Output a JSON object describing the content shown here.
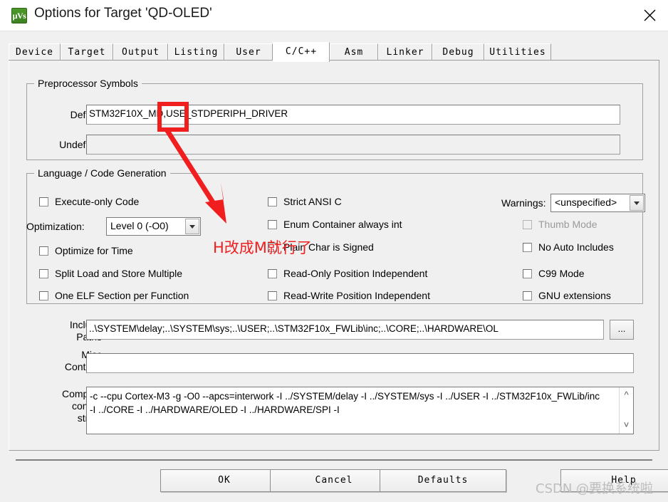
{
  "window": {
    "title": "Options for Target 'QD-OLED'",
    "app_icon": "keil-uvision-icon",
    "close_icon": "close-icon"
  },
  "tabs": [
    {
      "label": "Device",
      "selected": false
    },
    {
      "label": "Target",
      "selected": false
    },
    {
      "label": "Output",
      "selected": false
    },
    {
      "label": "Listing",
      "selected": false
    },
    {
      "label": "User",
      "selected": false
    },
    {
      "label": "C/C++",
      "selected": true
    },
    {
      "label": "Asm",
      "selected": false
    },
    {
      "label": "Linker",
      "selected": false
    },
    {
      "label": "Debug",
      "selected": false
    },
    {
      "label": "Utilities",
      "selected": false
    }
  ],
  "preprocessor": {
    "group_title": "Preprocessor Symbols",
    "define_label": "Define:",
    "define_value": "STM32F10X_MD,USE_STDPERIPH_DRIVER",
    "undefine_label": "Undefine:",
    "undefine_value": ""
  },
  "language": {
    "group_title": "Language / Code Generation",
    "column_left": [
      {
        "label": "Execute-only Code",
        "checked": false,
        "enabled": true
      },
      {
        "label": "Optimize for Time",
        "checked": false,
        "enabled": true
      },
      {
        "label": "Split Load and Store Multiple",
        "checked": false,
        "enabled": true
      },
      {
        "label": "One ELF Section per Function",
        "checked": false,
        "enabled": true
      }
    ],
    "optimization_label": "Optimization:",
    "optimization_value": "Level 0 (-O0)",
    "column_middle": [
      {
        "label": "Strict ANSI C",
        "checked": false,
        "enabled": true
      },
      {
        "label": "Enum Container always int",
        "checked": false,
        "enabled": true
      },
      {
        "label": "Plain Char is Signed",
        "checked": false,
        "enabled": true
      },
      {
        "label": "Read-Only Position Independent",
        "checked": false,
        "enabled": true
      },
      {
        "label": "Read-Write Position Independent",
        "checked": false,
        "enabled": true
      }
    ],
    "warnings_label": "Warnings:",
    "warnings_value": "<unspecified>",
    "column_right": [
      {
        "label": "Thumb Mode",
        "checked": false,
        "enabled": false
      },
      {
        "label": "No Auto Includes",
        "checked": false,
        "enabled": true
      },
      {
        "label": "C99 Mode",
        "checked": false,
        "enabled": true
      },
      {
        "label": "GNU extensions",
        "checked": false,
        "enabled": true
      }
    ]
  },
  "paths": {
    "include_label_line1": "Include",
    "include_label_line2": "Paths",
    "include_value": "..\\SYSTEM\\delay;..\\SYSTEM\\sys;..\\USER;..\\STM32F10x_FWLib\\inc;..\\CORE;..\\HARDWARE\\OL",
    "browse_label": "...",
    "misc_label_line1": "Misc",
    "misc_label_line2": "Controls",
    "misc_value": "",
    "compiler_label_line1": "Compiler",
    "compiler_label_line2": "control",
    "compiler_label_line3": "string",
    "compiler_value": "-c --cpu Cortex-M3 -g -O0 --apcs=interwork -I ../SYSTEM/delay -I ../SYSTEM/sys -I ../USER -I ../STM32F10x_FWLib/inc -I ../CORE -I ../HARDWARE/OLED -I ../HARDWARE/SPI -I",
    "scroll_up_icon": "chevron-up-icon",
    "scroll_down_icon": "chevron-down-icon"
  },
  "buttons": {
    "ok": "OK",
    "cancel": "Cancel",
    "defaults": "Defaults",
    "help": "Help"
  },
  "annotations": {
    "red_box_target": "_MD",
    "red_note": "H改成M就行了",
    "watermark": "CSDN @要换系统啦",
    "accent_red": "#f01e1e"
  }
}
